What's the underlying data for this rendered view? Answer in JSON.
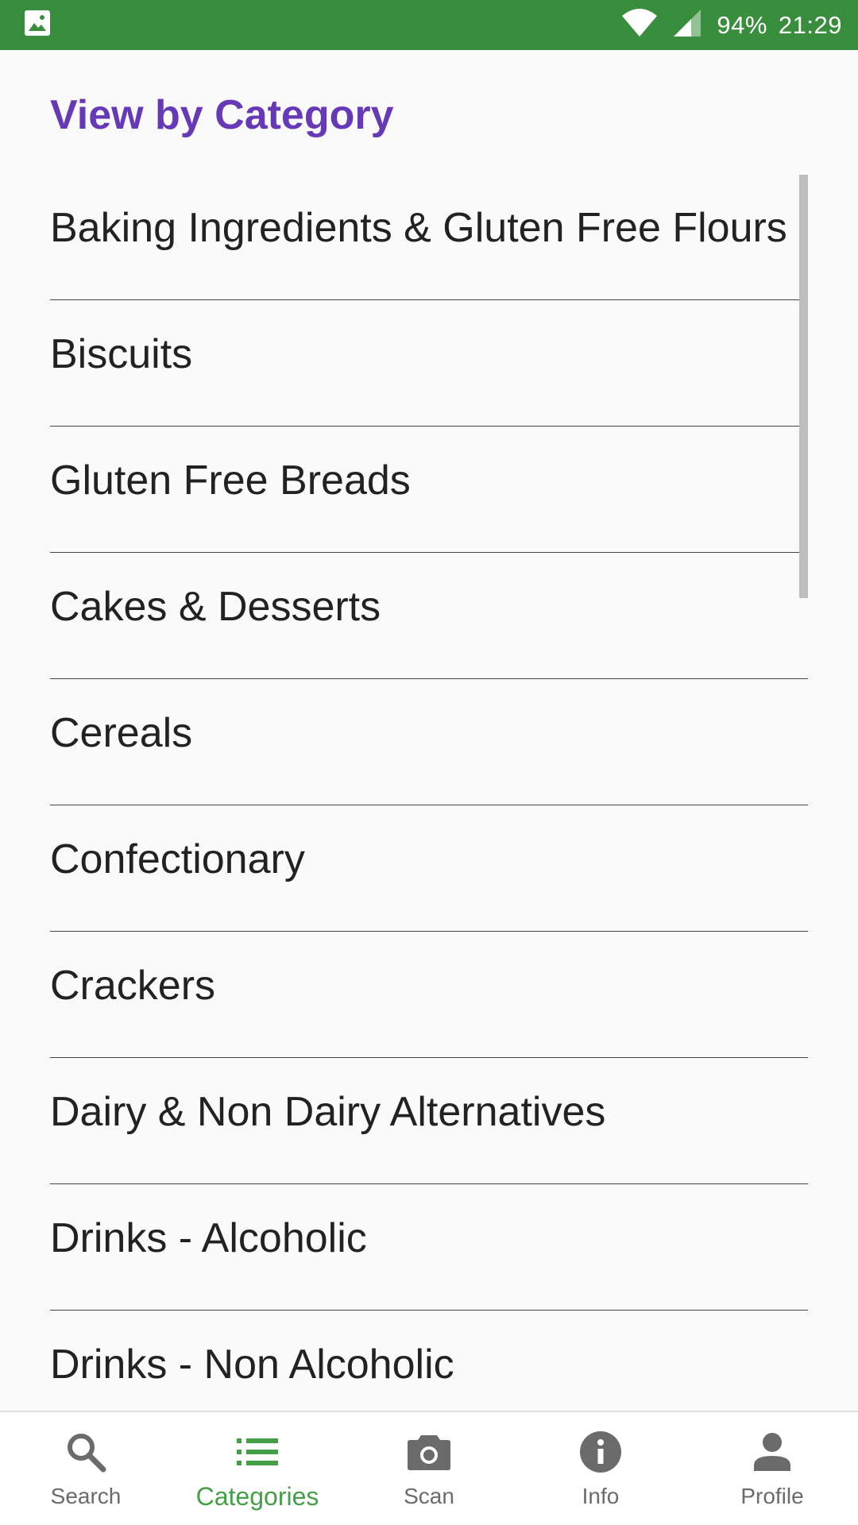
{
  "status_bar": {
    "battery": "94%",
    "time": "21:29"
  },
  "page": {
    "title": "View by Category"
  },
  "categories": [
    {
      "label": "Baking Ingredients & Gluten Free Flours"
    },
    {
      "label": "Biscuits"
    },
    {
      "label": "Gluten Free Breads"
    },
    {
      "label": "Cakes & Desserts"
    },
    {
      "label": "Cereals"
    },
    {
      "label": "Confectionary"
    },
    {
      "label": "Crackers"
    },
    {
      "label": "Dairy & Non Dairy Alternatives"
    },
    {
      "label": "Drinks - Alcoholic"
    },
    {
      "label": "Drinks - Non Alcoholic"
    }
  ],
  "bottom_nav": {
    "active": "Categories",
    "items": [
      {
        "label": "Search",
        "icon": "search-icon"
      },
      {
        "label": "Categories",
        "icon": "list-icon"
      },
      {
        "label": "Scan",
        "icon": "camera-icon"
      },
      {
        "label": "Info",
        "icon": "info-icon"
      },
      {
        "label": "Profile",
        "icon": "person-icon"
      }
    ]
  },
  "colors": {
    "status_bar": "#388e3c",
    "title": "#6639b7",
    "active_nav": "#43a047",
    "inactive_nav": "#6b6b6b"
  }
}
